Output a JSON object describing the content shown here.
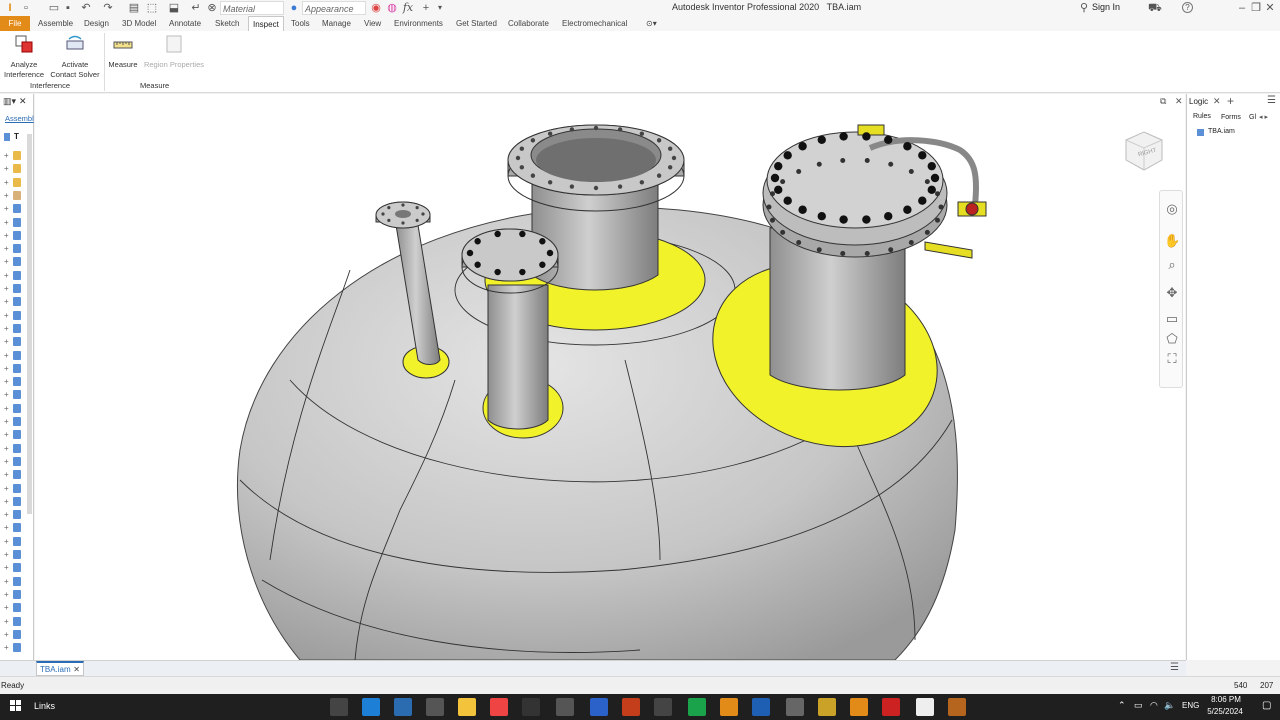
{
  "title_bar": {
    "app_title": "Autodesk Inventor Professional 2020",
    "doc_title": "TBA.iam",
    "material_placeholder": "Material",
    "appearance_placeholder": "Appearance",
    "fx": "fx",
    "sign_in": "Sign In"
  },
  "menu": {
    "file": "File",
    "tabs": [
      "Assemble",
      "Design",
      "3D Model",
      "Annotate",
      "Sketch",
      "Inspect",
      "Tools",
      "Manage",
      "View",
      "Environments",
      "Get Started",
      "Collaborate",
      "Electromechanical"
    ],
    "active_tab": "Inspect"
  },
  "ribbon": {
    "analyze_interference_1": "Analyze",
    "analyze_interference_2": "Interference",
    "activate_contact_1": "Activate",
    "activate_contact_2": "Contact Solver",
    "measure": "Measure",
    "region_properties": "Region Properties",
    "group_interference": "Interference",
    "group_measure": "Measure"
  },
  "browser": {
    "tab_label": "Assembl",
    "root_label": "T"
  },
  "viewcube": {
    "face": "RIGHT"
  },
  "ilogic": {
    "title": "Logic",
    "tabs": [
      "Rules",
      "Forms",
      "Gl"
    ],
    "items": [
      "TBA.iam"
    ]
  },
  "doc_tabs": {
    "active": "TBA.iam"
  },
  "status": {
    "text": "Ready",
    "count1": "540",
    "count2": "207"
  },
  "taskbar": {
    "links": "Links",
    "lang": "ENG",
    "time": "8:06 PM",
    "date": "5/25/2024"
  },
  "colors": {
    "accent_file": "#e38b19",
    "yellow_pad": "#f2f22a",
    "vessel_gray": "#c9c9c9"
  }
}
